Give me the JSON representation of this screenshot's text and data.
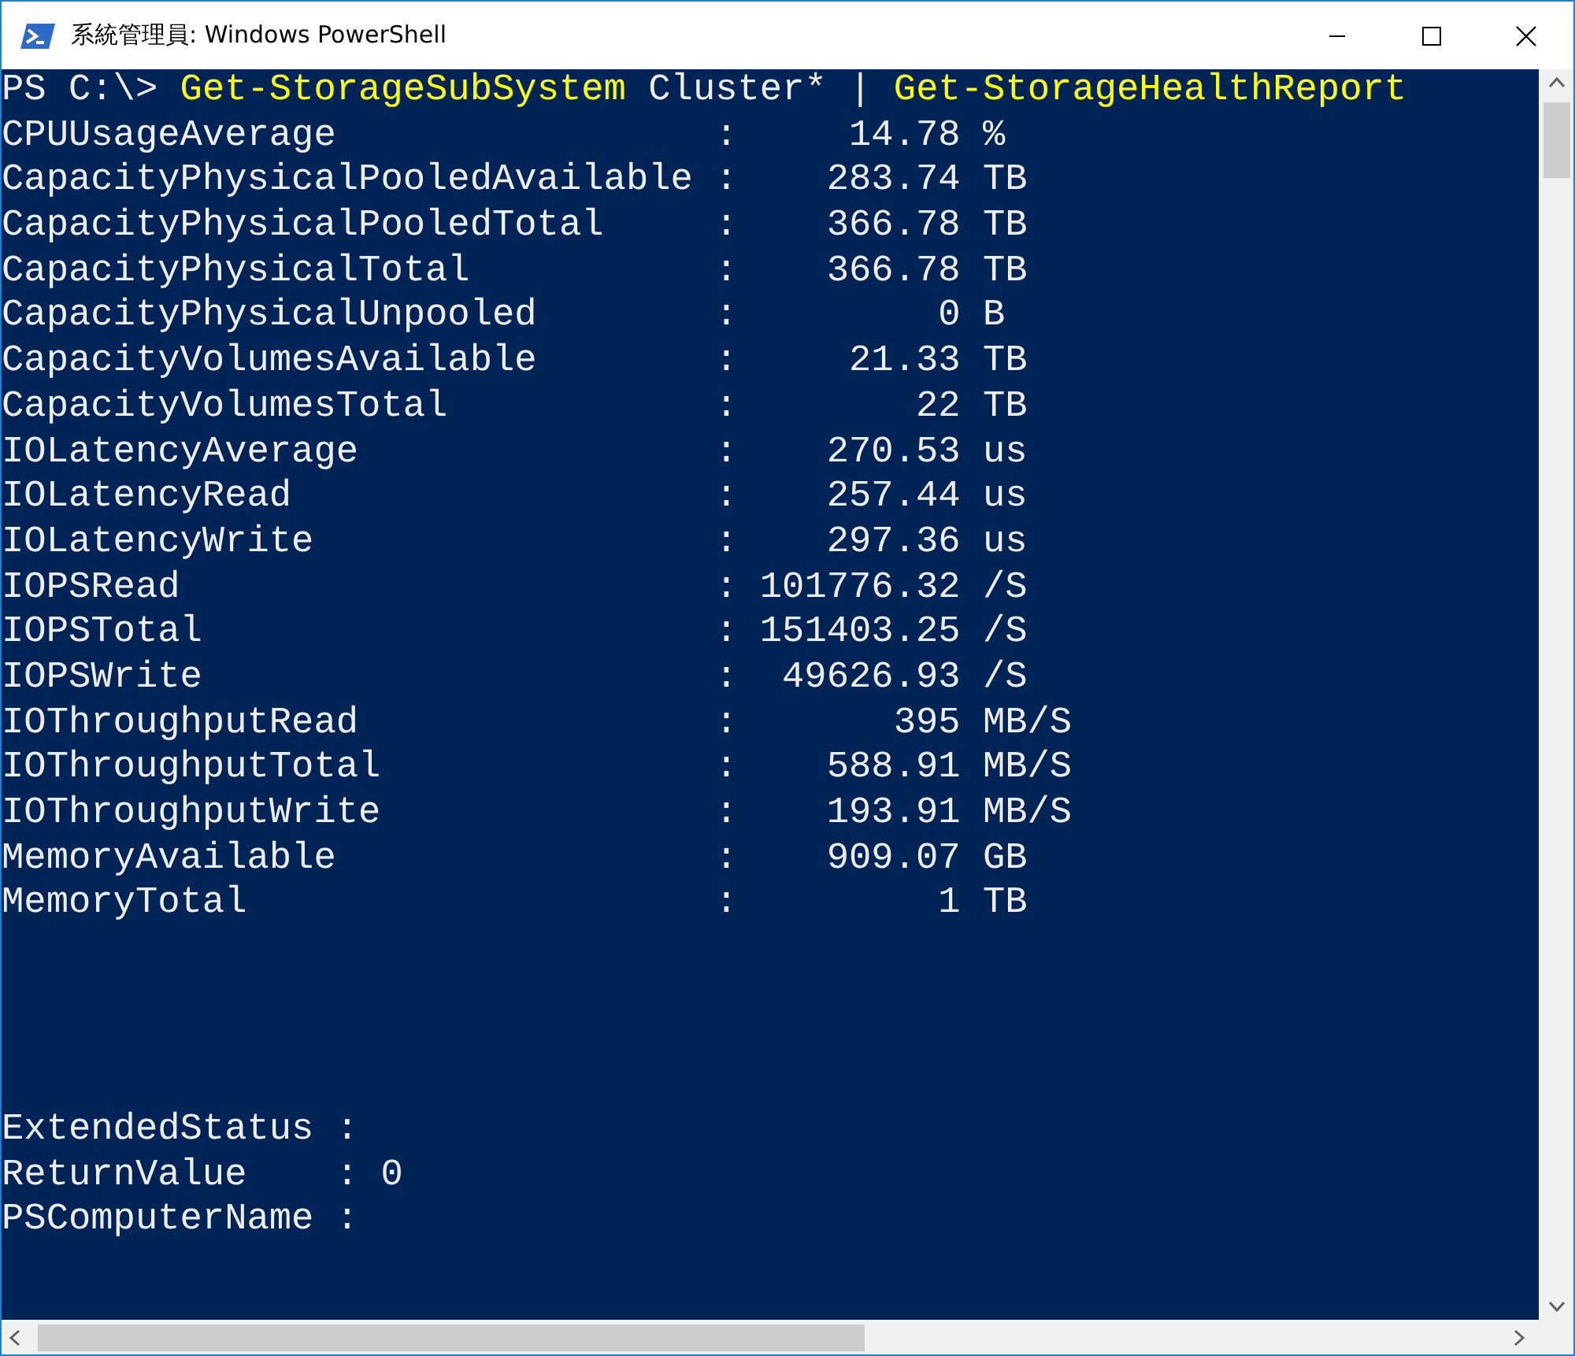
{
  "window": {
    "title": "系統管理員: Windows PowerShell"
  },
  "prompt_line": {
    "prompt": "PS C:\\>",
    "tokens": [
      {
        "text": "Get-StorageSubSystem",
        "kind": "command"
      },
      {
        "text": "Cluster*",
        "kind": "argument"
      },
      {
        "text": "|",
        "kind": "operator"
      },
      {
        "text": "Get-StorageHealthReport",
        "kind": "command"
      }
    ]
  },
  "metrics": [
    {
      "name": "CPUUsageAverage",
      "separator": ":",
      "value": "14.78",
      "unit": "%"
    },
    {
      "name": "CapacityPhysicalPooledAvailable",
      "separator": ":",
      "value": "283.74",
      "unit": "TB"
    },
    {
      "name": "CapacityPhysicalPooledTotal",
      "separator": ":",
      "value": "366.78",
      "unit": "TB"
    },
    {
      "name": "CapacityPhysicalTotal",
      "separator": ":",
      "value": "366.78",
      "unit": "TB"
    },
    {
      "name": "CapacityPhysicalUnpooled",
      "separator": ":",
      "value": "0",
      "unit": "B"
    },
    {
      "name": "CapacityVolumesAvailable",
      "separator": ":",
      "value": "21.33",
      "unit": "TB"
    },
    {
      "name": "CapacityVolumesTotal",
      "separator": ":",
      "value": "22",
      "unit": "TB"
    },
    {
      "name": "IOLatencyAverage",
      "separator": ":",
      "value": "270.53",
      "unit": "us"
    },
    {
      "name": "IOLatencyRead",
      "separator": ":",
      "value": "257.44",
      "unit": "us"
    },
    {
      "name": "IOLatencyWrite",
      "separator": ":",
      "value": "297.36",
      "unit": "us"
    },
    {
      "name": "IOPSRead",
      "separator": ":",
      "value": "101776.32",
      "unit": "/S"
    },
    {
      "name": "IOPSTotal",
      "separator": ":",
      "value": "151403.25",
      "unit": "/S"
    },
    {
      "name": "IOPSWrite",
      "separator": ":",
      "value": "49626.93",
      "unit": "/S"
    },
    {
      "name": "IOThroughputRead",
      "separator": ":",
      "value": "395",
      "unit": "MB/S"
    },
    {
      "name": "IOThroughputTotal",
      "separator": ":",
      "value": "588.91",
      "unit": "MB/S"
    },
    {
      "name": "IOThroughputWrite",
      "separator": ":",
      "value": "193.91",
      "unit": "MB/S"
    },
    {
      "name": "MemoryAvailable",
      "separator": ":",
      "value": "909.07",
      "unit": "GB"
    },
    {
      "name": "MemoryTotal",
      "separator": ":",
      "value": "1",
      "unit": "TB"
    }
  ],
  "properties": [
    {
      "name": "ExtendedStatus",
      "separator": ":"
    },
    {
      "name": "ReturnValue",
      "separator": ":",
      "value": "0"
    },
    {
      "name": "PSComputerName",
      "separator": ":"
    }
  ]
}
